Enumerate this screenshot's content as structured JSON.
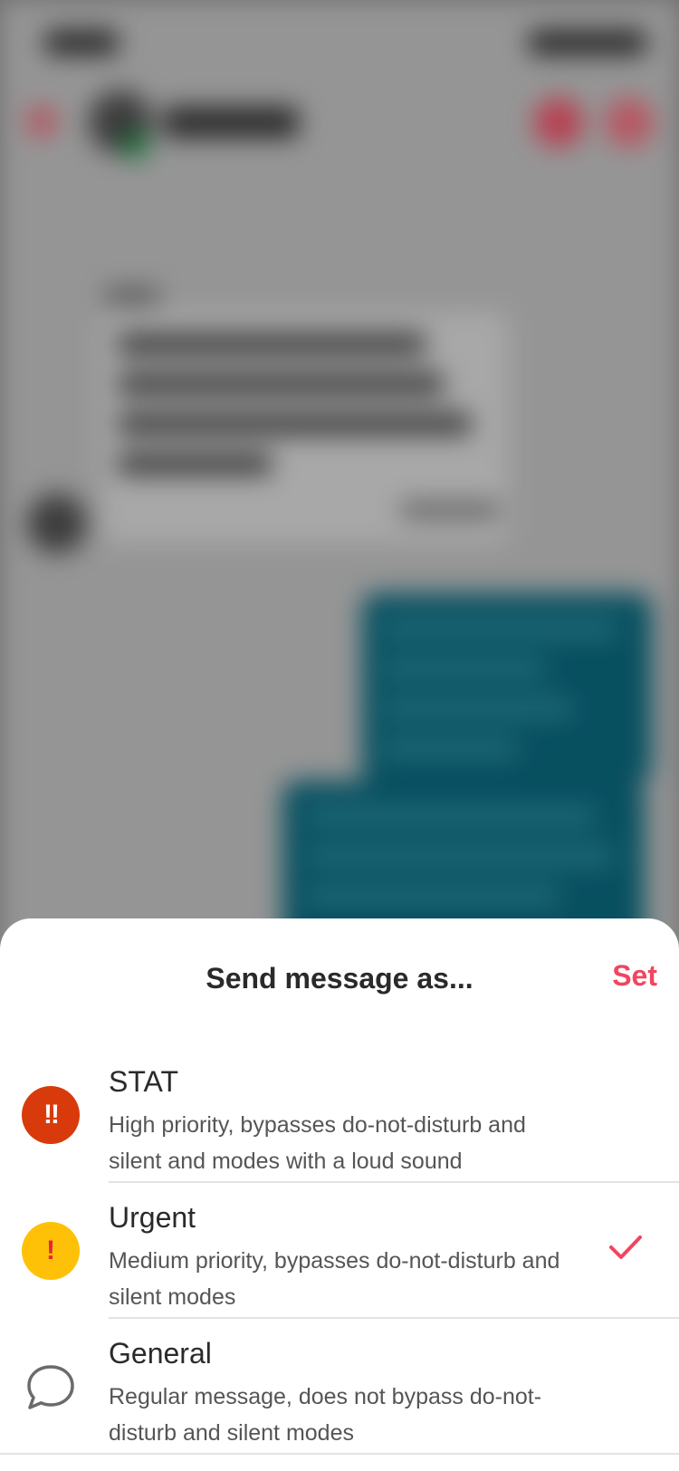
{
  "sheet": {
    "title": "Send message as...",
    "set_label": "Set"
  },
  "options": [
    {
      "title": "STAT",
      "description": "High priority, bypasses do-not-disturb and silent and modes with a loud sound",
      "badge": "!!",
      "icon": "double-exclamation-icon",
      "color": "#d83a0c",
      "selected": false
    },
    {
      "title": "Urgent",
      "description": "Medium priority, bypasses do-not-disturb and silent modes",
      "badge": "!",
      "icon": "exclamation-icon",
      "color": "#ffc107",
      "selected": true
    },
    {
      "title": "General",
      "description": "Regular message, does not bypass do-not-disturb and silent modes",
      "icon": "chat-bubble-icon",
      "selected": false
    }
  ],
  "colors": {
    "accent": "#f2455e",
    "outgoing_bubble": "#0b6f86"
  }
}
